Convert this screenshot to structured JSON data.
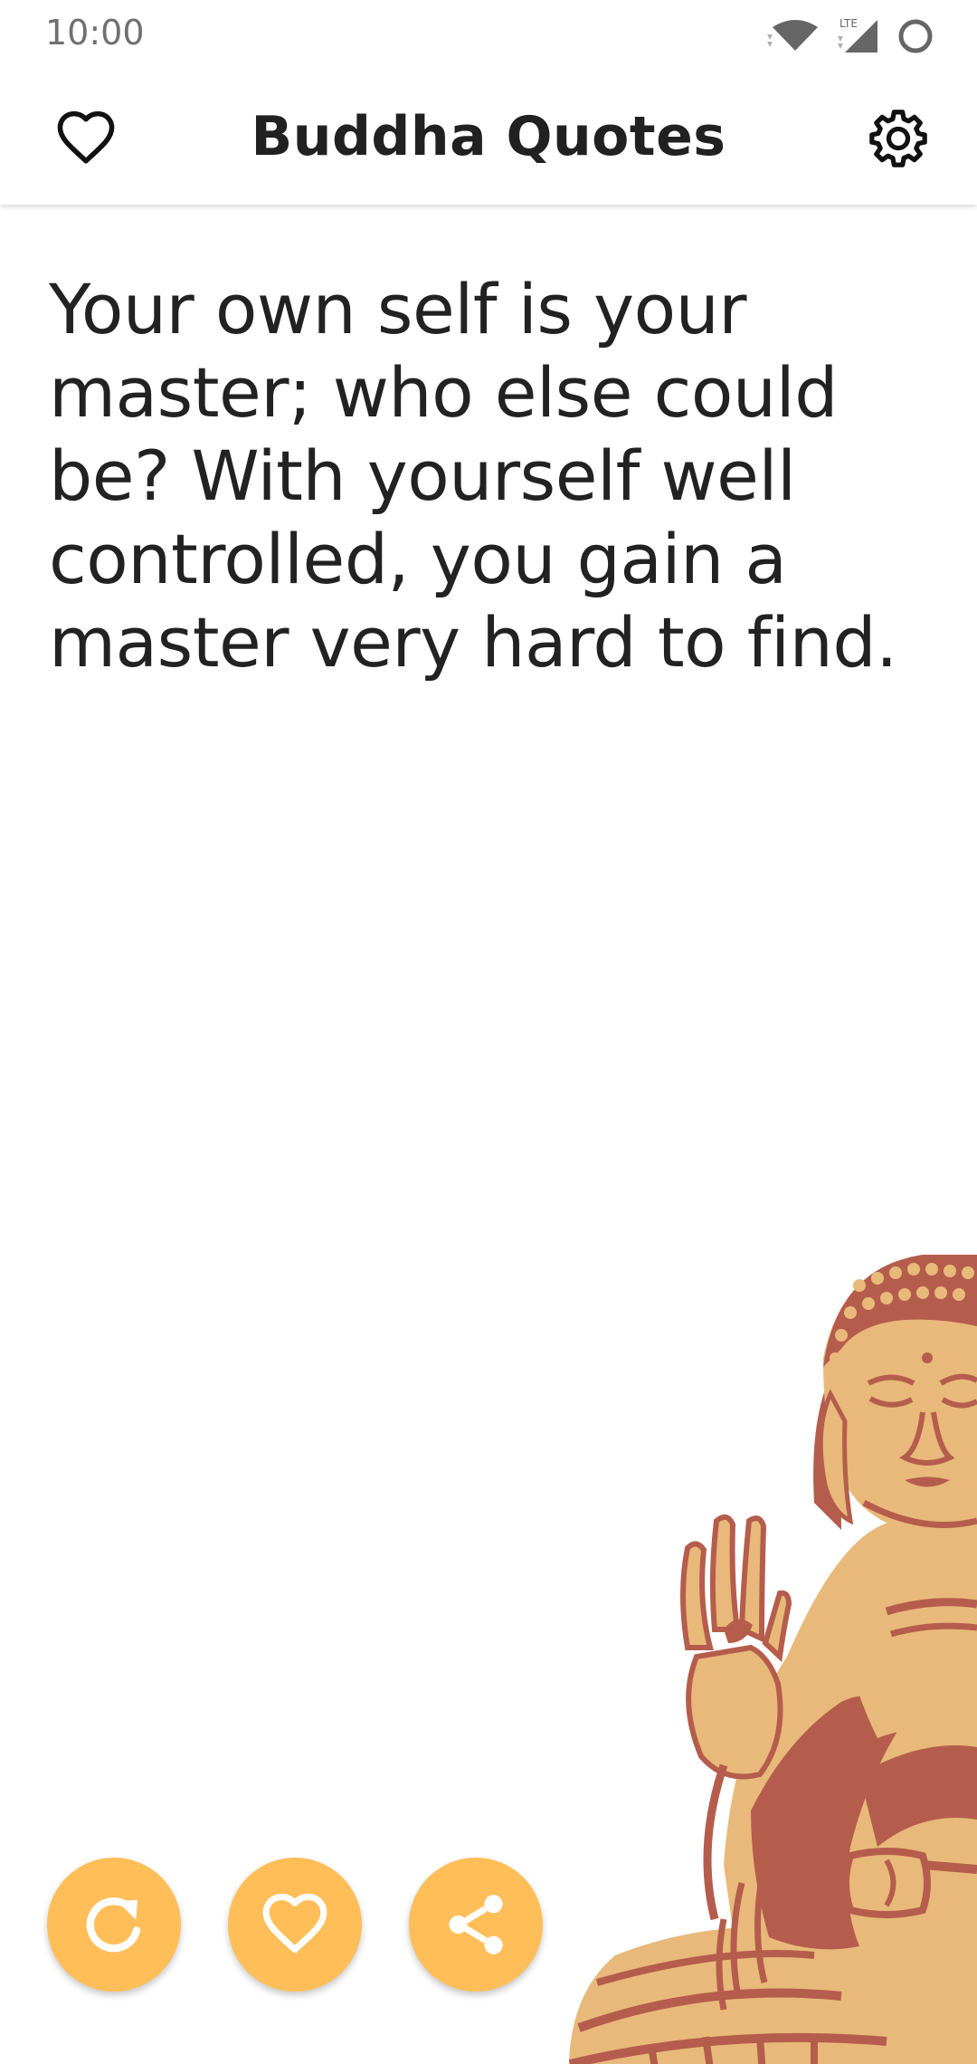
{
  "status_bar": {
    "time": "10:00",
    "network": "LTE",
    "icons": [
      "wifi-icon",
      "cell-signal-icon",
      "battery-icon"
    ]
  },
  "app_bar": {
    "title": "Buddha Quotes",
    "left_icon": "heart-outline-icon",
    "right_icon": "gear-icon"
  },
  "quote": {
    "text": "Your own self is your master; who else could be? With yourself well controlled, you gain a master very hard to find."
  },
  "actions": [
    {
      "name": "refresh",
      "icon": "refresh-icon"
    },
    {
      "name": "favorite",
      "icon": "heart-outline-icon"
    },
    {
      "name": "share",
      "icon": "share-icon"
    }
  ],
  "colors": {
    "accent": "#ffbe57",
    "statue_light": "#e8b97a",
    "statue_dark": "#b55d4c",
    "text": "#222222"
  }
}
